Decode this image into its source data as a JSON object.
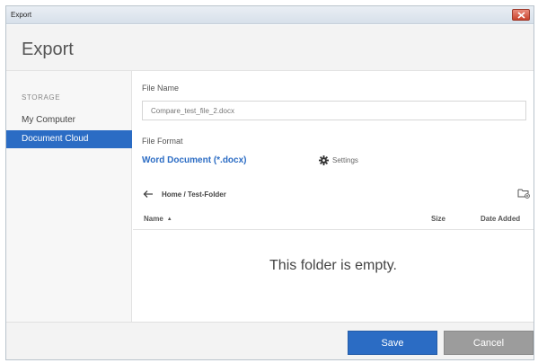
{
  "window": {
    "title": "Export"
  },
  "header": {
    "title": "Export"
  },
  "sidebar": {
    "section_label": "STORAGE",
    "items": [
      {
        "label": "My Computer",
        "selected": false
      },
      {
        "label": "Document Cloud",
        "selected": true
      }
    ]
  },
  "form": {
    "file_name_label": "File Name",
    "file_name_value": "Compare_test_file_2.docx",
    "file_format_label": "File Format",
    "file_format_value": "Word Document (*.docx)",
    "settings_label": "Settings"
  },
  "browser": {
    "breadcrumb": "Home / Test-Folder",
    "columns": {
      "name": "Name",
      "size": "Size",
      "date": "Date Added"
    },
    "sort_indicator": "▲",
    "empty_message": "This folder is empty."
  },
  "footer": {
    "save_label": "Save",
    "cancel_label": "Cancel"
  },
  "colors": {
    "accent": "#2b6cc4",
    "cancel": "#9c9c9c",
    "close": "#c8422c"
  }
}
